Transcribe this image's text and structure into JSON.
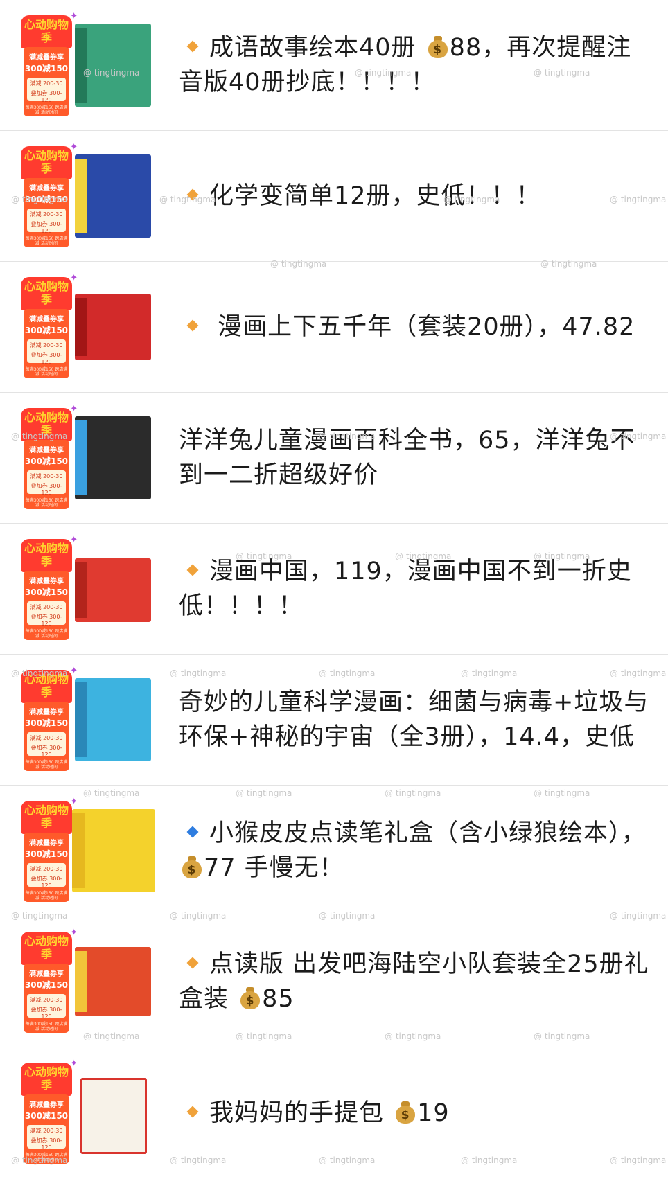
{
  "badge": {
    "title": "心动购物季",
    "line1": "满减叠券享",
    "line2": "300减150",
    "coupon_1": "满减 200-30",
    "coupon_2": "叠加券 300-120",
    "footer": "每满300减150 跨店满减 活动时间"
  },
  "watermark": "@ tingtingma",
  "items": [
    {
      "text": "成语故事绘本40册 ",
      "money": true,
      "tail": "88，再次提醒注音版40册抄底！！！！",
      "bullet": "orange",
      "cover_color": "#3aa37c",
      "icon": "book-set-icon"
    },
    {
      "text": "化学变简单12册，史低！！！",
      "money": false,
      "tail": "",
      "bullet": "orange",
      "cover_color": "#2a4aa8",
      "icon": "book-set-icon"
    },
    {
      "text": " 漫画上下五千年（套装20册），47.82",
      "money": false,
      "tail": "",
      "bullet": "orange",
      "cover_color": "#d22a2a",
      "icon": "gift-box-icon"
    },
    {
      "text": "洋洋兔儿童漫画百科全书，65，洋洋兔不到一二折超级好价",
      "money": false,
      "tail": "",
      "bullet": "none",
      "cover_color": "#2b2b2b",
      "icon": "book-set-icon"
    },
    {
      "text": "漫画中国，119，漫画中国不到一折史低！！！！",
      "money": false,
      "tail": "",
      "bullet": "orange",
      "cover_color": "#e03a30",
      "icon": "gift-box-icon"
    },
    {
      "text": "奇妙的儿童科学漫画：细菌与病毒+垃圾与环保+神秘的宇宙（全3册），14.4，史低",
      "money": false,
      "tail": "",
      "bullet": "none",
      "cover_color": "#3db3e0",
      "icon": "book-set-icon"
    },
    {
      "text": "小猴皮皮点读笔礼盒（含小绿狼绘本），",
      "money": true,
      "tail": "77 手慢无！",
      "bullet": "blue",
      "cover_color": "#f4d22c",
      "icon": "reading-pen-icon"
    },
    {
      "text": "点读版 出发吧海陆空小队套装全25册礼盒装 ",
      "money": true,
      "tail": "85",
      "bullet": "orange",
      "cover_color": "#e34b2a",
      "icon": "gift-box-icon"
    },
    {
      "text": "我妈妈的手提包 ",
      "money": true,
      "tail": "19",
      "bullet": "orange",
      "cover_color": "#d9342d",
      "icon": "handbag-icon"
    }
  ]
}
